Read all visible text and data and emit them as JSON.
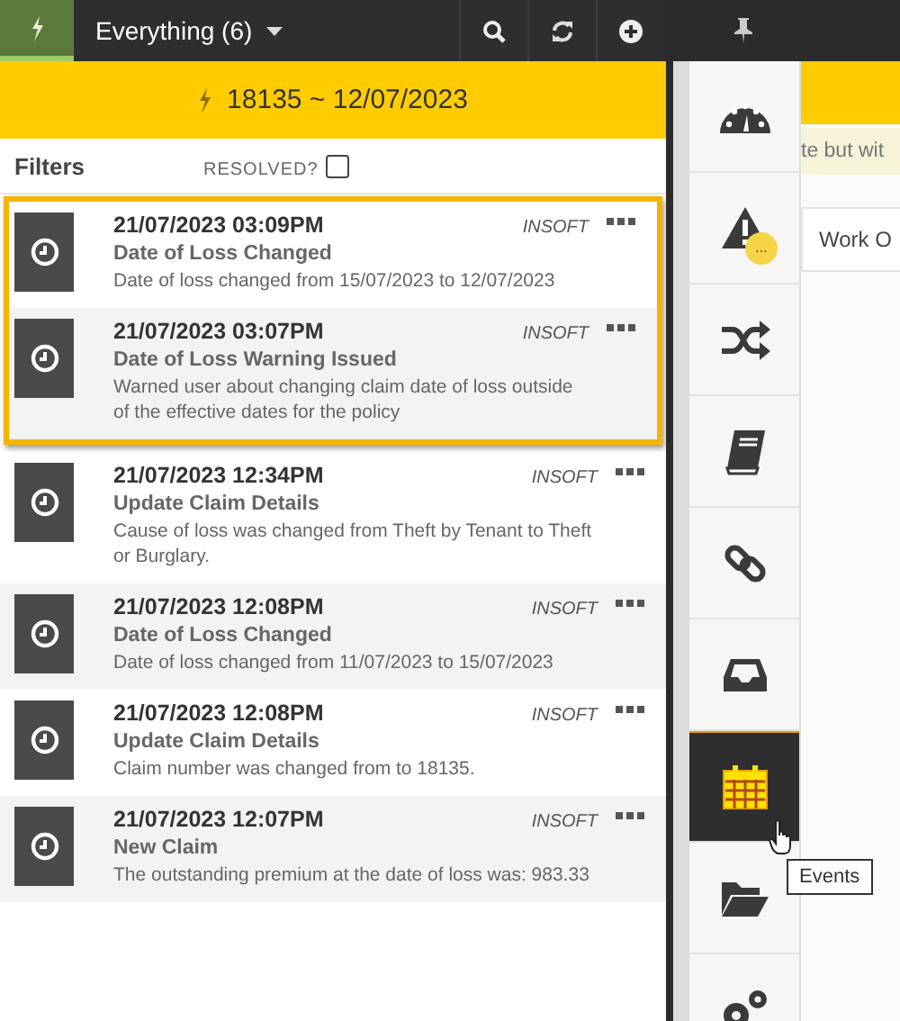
{
  "toolbar": {
    "filter_label": "Everything (6)"
  },
  "claim_header": {
    "title": "18135 ~ 12/07/2023"
  },
  "filters": {
    "label": "Filters",
    "resolved_label": "RESOLVED?",
    "resolved_checked": false
  },
  "events": [
    {
      "timestamp": "21/07/2023 03:09PM",
      "source": "INSOFT",
      "title": "Date of Loss Changed",
      "description": "Date of loss changed from 15/07/2023 to 12/07/2023",
      "highlighted": true
    },
    {
      "timestamp": "21/07/2023 03:07PM",
      "source": "INSOFT",
      "title": "Date of Loss Warning Issued",
      "description": "Warned user about changing claim date of loss outside of the effective dates for the policy",
      "highlighted": true
    },
    {
      "timestamp": "21/07/2023 12:34PM",
      "source": "INSOFT",
      "title": "Update Claim Details",
      "description": "Cause of loss was changed from Theft by Tenant to Theft or Burglary.",
      "highlighted": false
    },
    {
      "timestamp": "21/07/2023 12:08PM",
      "source": "INSOFT",
      "title": "Date of Loss Changed",
      "description": "Date of loss changed from 11/07/2023 to 15/07/2023",
      "highlighted": false
    },
    {
      "timestamp": "21/07/2023 12:08PM",
      "source": "INSOFT",
      "title": "Update Claim Details",
      "description": "Claim number was changed from to 18135.",
      "highlighted": false
    },
    {
      "timestamp": "21/07/2023 12:07PM",
      "source": "INSOFT",
      "title": "New Claim",
      "description": "The outstanding premium at the date of loss was: 983.33",
      "highlighted": false
    }
  ],
  "side_rail": {
    "items": [
      {
        "kind": "gauge",
        "selected": false
      },
      {
        "kind": "warning",
        "selected": false,
        "badge": "..."
      },
      {
        "kind": "shuffle",
        "selected": false
      },
      {
        "kind": "book",
        "selected": false
      },
      {
        "kind": "link",
        "selected": false
      },
      {
        "kind": "inbox",
        "selected": false
      },
      {
        "kind": "calendar",
        "selected": true
      },
      {
        "kind": "folder",
        "selected": false
      },
      {
        "kind": "gears",
        "selected": false
      }
    ]
  },
  "tooltip": "Events",
  "background_page": {
    "banner_text": "te but wit",
    "tab_label": "Work O"
  }
}
